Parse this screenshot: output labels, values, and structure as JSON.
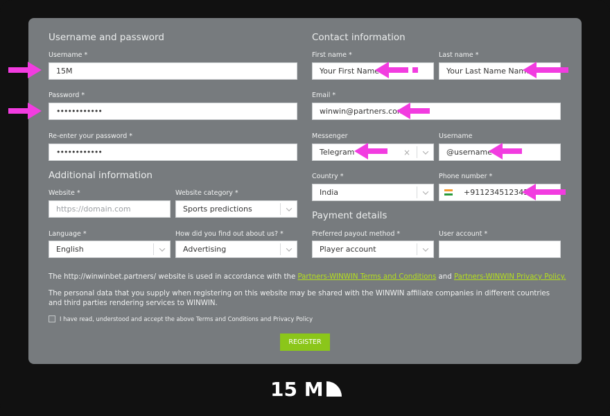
{
  "sections": {
    "username_password": "Username and password",
    "contact": "Contact information",
    "additional": "Additional information",
    "payment": "Payment details"
  },
  "fields": {
    "username": {
      "label": "Username *",
      "value": "15M"
    },
    "password": {
      "label": "Password *",
      "value": "••••••••••••"
    },
    "reenter": {
      "label": "Re-enter your password *",
      "value": "••••••••••••"
    },
    "first_name": {
      "label": "First name *",
      "value": "Your First Name"
    },
    "last_name": {
      "label": "Last name *",
      "value": "Your Last Name Name"
    },
    "email": {
      "label": "Email *",
      "value": "winwin@partners.com"
    },
    "messenger": {
      "label": "Messenger",
      "value": "Telegram",
      "clear": "×"
    },
    "messenger_username": {
      "label": "Username",
      "value": "@username"
    },
    "country": {
      "label": "Country *",
      "value": "India"
    },
    "phone": {
      "label": "Phone number *",
      "value": "+911234512345"
    },
    "website": {
      "label": "Website *",
      "placeholder": "https://domain.com"
    },
    "website_category": {
      "label": "Website category *",
      "value": "Sports predictions"
    },
    "language": {
      "label": "Language *",
      "value": "English"
    },
    "found_us": {
      "label": "How did you find out about us? *",
      "value": "Advertising"
    },
    "payout_method": {
      "label": "Preferred payout method *",
      "value": "Player account"
    },
    "user_account": {
      "label": "User account *",
      "value": ""
    }
  },
  "terms": {
    "line1_prefix": "The http://winwinbet.partners/ website is used in accordance with the ",
    "terms_link": "Partners-WINWIN Terms and Conditions",
    "and": " and ",
    "privacy_link": "Partners-WINWIN Privacy Policy.",
    "line2": "The personal data that you supply when registering on this website may be shared with the WINWIN affiliate companies in different countries and third parties rendering services to WINWIN.",
    "checkbox_label": "I have read, understood and accept the above Terms and Conditions and Privacy Policy"
  },
  "register_label": "REGISTER",
  "logo_text": "15 M",
  "colors": {
    "arrow": "#f23ce0",
    "accent": "#8bc61a",
    "link": "#b5e01c",
    "panel": "#777b7e"
  }
}
